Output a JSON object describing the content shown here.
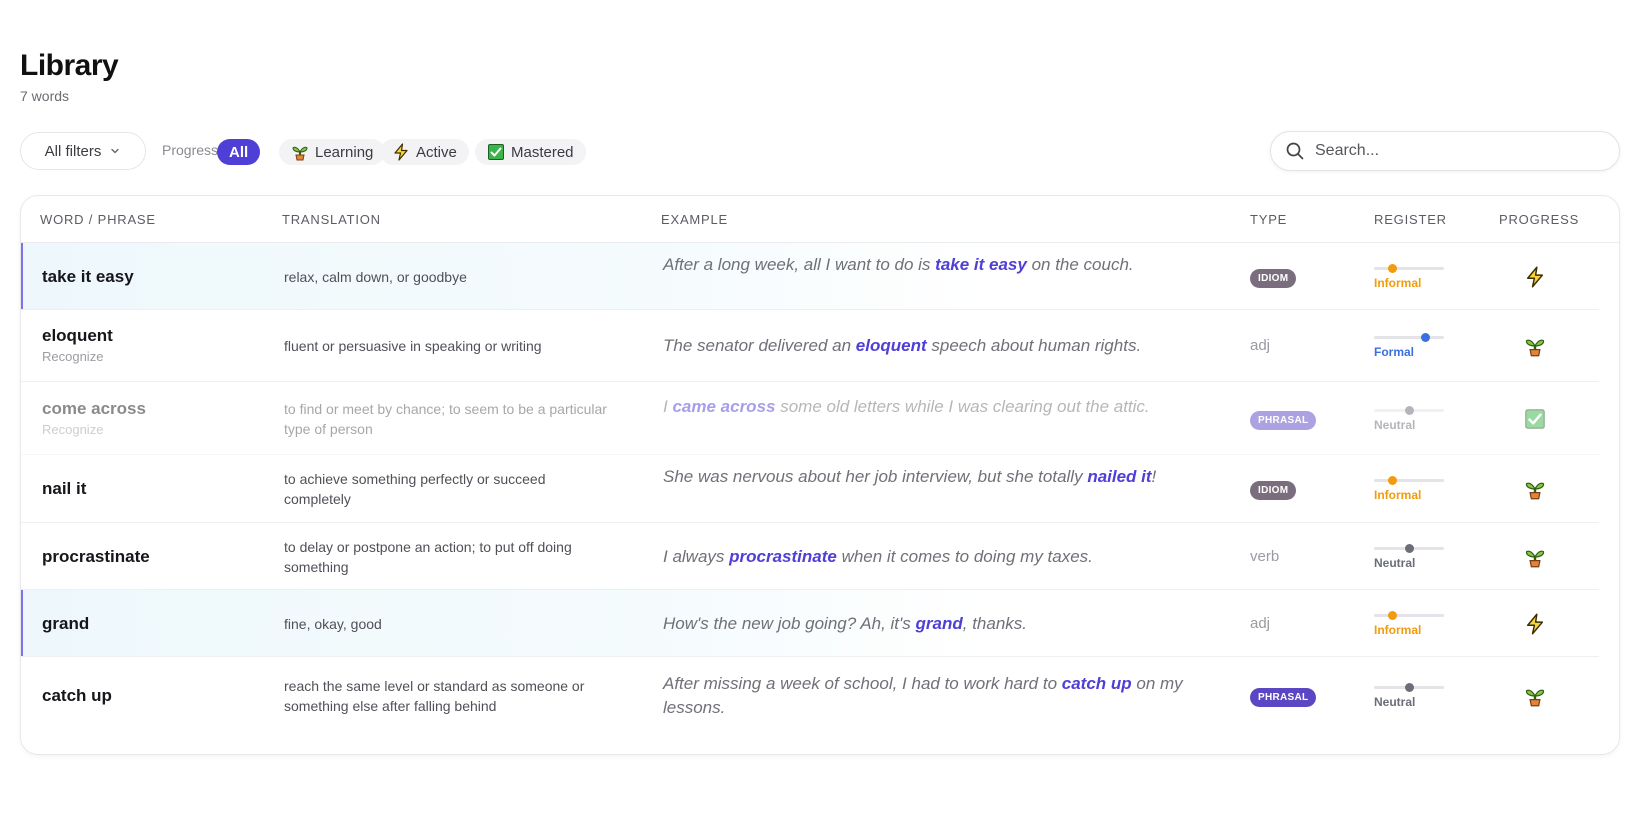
{
  "header": {
    "title": "Library",
    "subtitle": "7 words"
  },
  "toolbar": {
    "filters_label": "All filters",
    "progress_label": "Progress",
    "chips": [
      {
        "label": "All",
        "icon": "none",
        "active": true
      },
      {
        "label": "Learning",
        "icon": "sprout-icon",
        "active": false
      },
      {
        "label": "Active",
        "icon": "lightning-icon",
        "active": false
      },
      {
        "label": "Mastered",
        "icon": "checkmark-box-icon",
        "active": false
      }
    ],
    "search_placeholder": "Search..."
  },
  "table": {
    "columns": [
      "Word / Phrase",
      "Translation",
      "Example",
      "Type",
      "Register",
      "Progress"
    ],
    "rows": [
      {
        "word": "take it easy",
        "sub": "",
        "translation": "relax, calm down, or goodbye",
        "example_pre": "After a long week, all I want to do is ",
        "example_hl": "take it easy",
        "example_post": " on the couch.",
        "type": "IDIOM",
        "register": "Informal",
        "register_level": 0.25,
        "register_color": "#f29b0c",
        "progress": "Active"
      },
      {
        "word": "eloquent",
        "sub": "Recognize",
        "translation": "fluent or persuasive in speaking or writing",
        "example_pre": "The senator delivered an ",
        "example_hl": "eloquent",
        "example_post": " speech about human rights.",
        "type": "adj",
        "register": "Formal",
        "register_level": 0.75,
        "register_color": "#3b6fe0",
        "progress": "Learning"
      },
      {
        "word": "come across",
        "sub": "Recognize",
        "translation": "to find or meet by chance; to seem to be a particular type of person",
        "example_pre": "I ",
        "example_hl": "came across",
        "example_post": " some old letters while I was clearing out the attic.",
        "type": "PHRASAL",
        "register": "Neutral",
        "register_level": 0.5,
        "register_color": "#6b6e78",
        "progress": "Mastered"
      },
      {
        "word": "nail it",
        "sub": "",
        "translation": "to achieve something perfectly or succeed completely",
        "example_pre": "She was nervous about her job interview, but she totally ",
        "example_hl": "nailed it",
        "example_post": "!",
        "type": "IDIOM",
        "register": "Informal",
        "register_level": 0.25,
        "register_color": "#f29b0c",
        "progress": "Learning"
      },
      {
        "word": "procrastinate",
        "sub": "",
        "translation": "to delay or postpone an action; to put off doing something",
        "example_pre": "I always ",
        "example_hl": "procrastinate",
        "example_post": " when it comes to doing my taxes.",
        "type": "verb",
        "register": "Neutral",
        "register_level": 0.5,
        "register_color": "#6b6e78",
        "progress": "Learning"
      },
      {
        "word": "grand",
        "sub": "",
        "translation": "fine, okay, good",
        "example_pre": "How's the new job going? Ah, it's ",
        "example_hl": "grand",
        "example_post": ", thanks.",
        "type": "adj",
        "register": "Informal",
        "register_level": 0.25,
        "register_color": "#f29b0c",
        "progress": "Active"
      },
      {
        "word": "catch up",
        "sub": "",
        "translation": "reach the same level or standard as someone or something else after falling behind",
        "example_pre": "After missing a week of school, I had to work hard to ",
        "example_hl": "catch up",
        "example_post": " on my lessons.",
        "type": "PHRASAL",
        "register": "Neutral",
        "register_level": 0.5,
        "register_color": "#6b6e78",
        "progress": "Learning"
      }
    ]
  },
  "colors": {
    "accent": "#4f3fd6",
    "informal": "#f29b0c",
    "formal": "#3b6fe0",
    "neutral": "#6b6e78"
  }
}
